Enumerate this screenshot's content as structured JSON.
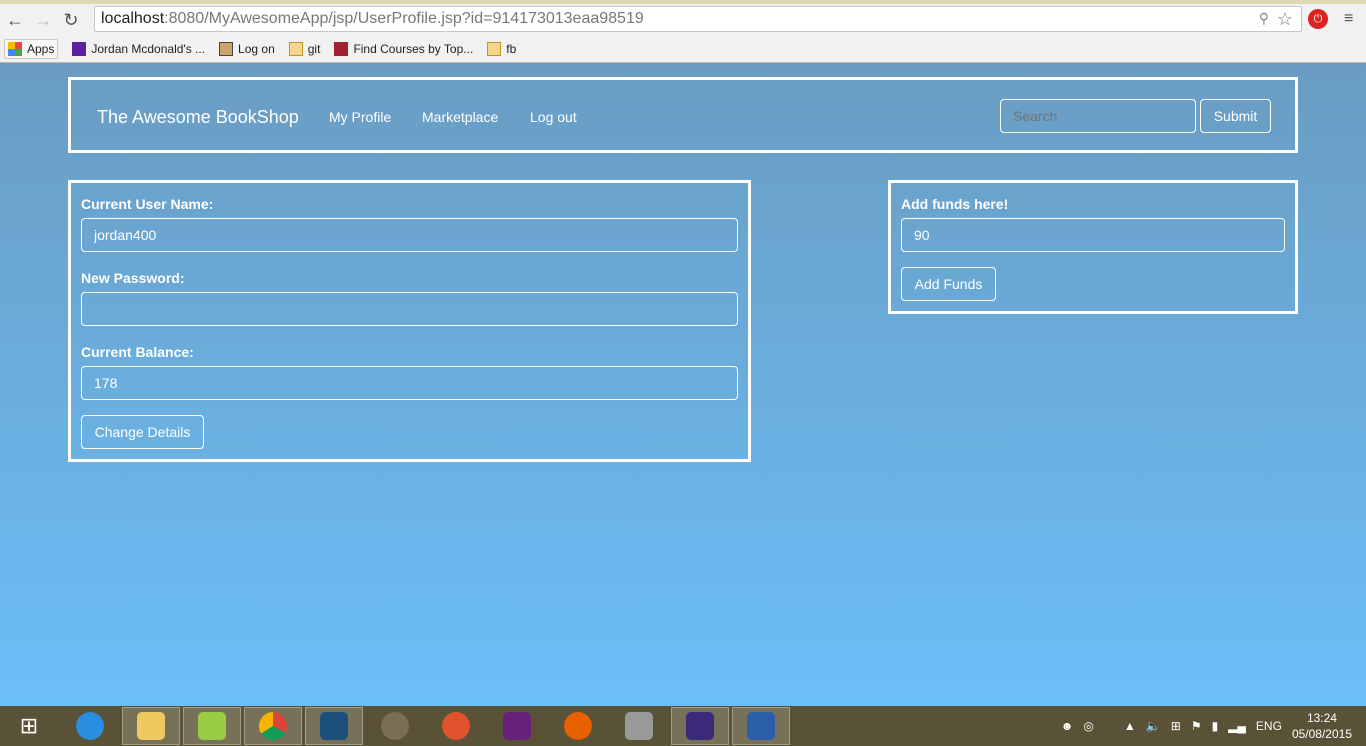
{
  "browser": {
    "url_host": "localhost",
    "url_rest": ":8080/MyAwesomeApp/jsp/UserProfile.jsp?id=914173013eaa98519",
    "bookmarks": [
      {
        "label": "Apps",
        "icon": "apps-grid-icon"
      },
      {
        "label": "Jordan Mcdonald's ...",
        "icon": "yahoo-icon"
      },
      {
        "label": "Log on",
        "icon": "tomcat-icon"
      },
      {
        "label": "git",
        "icon": "folder-icon"
      },
      {
        "label": "Find Courses by Top...",
        "icon": "mit-ocw-icon"
      },
      {
        "label": "fb",
        "icon": "folder-icon"
      }
    ]
  },
  "navbar": {
    "brand": "The Awesome BookShop",
    "links": [
      "My Profile",
      "Marketplace",
      "Log out"
    ],
    "search_placeholder": "Search",
    "submit": "Submit"
  },
  "profile": {
    "username_label": "Current User Name:",
    "username_value": "jordan400",
    "password_label": "New Password:",
    "password_value": "",
    "balance_label": "Current Balance:",
    "balance_value": "178",
    "change_button": "Change Details"
  },
  "funds": {
    "label": "Add funds here!",
    "value": "90",
    "button": "Add Funds"
  },
  "taskbar": {
    "lang": "ENG",
    "time": "13:24",
    "date": "05/08/2015"
  },
  "colors": {
    "bg_top": "#6a9cc2",
    "bg_bottom": "#6bbff8",
    "taskbar": "#5a5236"
  }
}
